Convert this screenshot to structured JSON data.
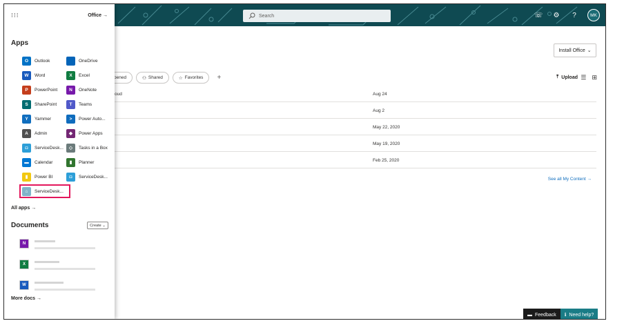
{
  "topbar": {
    "search_placeholder": "Search",
    "avatar_initials": "MK",
    "icons": [
      "settings-icon",
      "help-icon",
      "feedback-icon"
    ]
  },
  "launcher": {
    "office_link": "Office",
    "apps_title": "Apps",
    "apps": [
      {
        "label": "Outlook",
        "icon": "outlook-icon",
        "color": "#0072c6",
        "glyph": "O"
      },
      {
        "label": "OneDrive",
        "icon": "onedrive-icon",
        "color": "#0364b8",
        "glyph": ""
      },
      {
        "label": "Word",
        "icon": "word-icon",
        "color": "#185abd",
        "glyph": "W"
      },
      {
        "label": "Excel",
        "icon": "excel-icon",
        "color": "#107c41",
        "glyph": "X"
      },
      {
        "label": "PowerPoint",
        "icon": "powerpoint-icon",
        "color": "#c43e1c",
        "glyph": "P"
      },
      {
        "label": "OneNote",
        "icon": "onenote-icon",
        "color": "#7719aa",
        "glyph": "N"
      },
      {
        "label": "SharePoint",
        "icon": "sharepoint-icon",
        "color": "#036c70",
        "glyph": "S"
      },
      {
        "label": "Teams",
        "icon": "teams-icon",
        "color": "#5059c9",
        "glyph": "T"
      },
      {
        "label": "Yammer",
        "icon": "yammer-icon",
        "color": "#106ebe",
        "glyph": "Y"
      },
      {
        "label": "Power Auto...",
        "icon": "power-automate-icon",
        "color": "#0f6cbd",
        "glyph": ">"
      },
      {
        "label": "Admin",
        "icon": "admin-icon",
        "color": "#505050",
        "glyph": "A"
      },
      {
        "label": "Power Apps",
        "icon": "power-apps-icon",
        "color": "#742774",
        "glyph": "◆"
      },
      {
        "label": "ServiceDesk...",
        "icon": "servicedesk-icon",
        "color": "#2d9fd8",
        "glyph": "◘"
      },
      {
        "label": "Tasks in a Box",
        "icon": "tasks-in-a-box-icon",
        "color": "#6b7b7b",
        "glyph": "◇"
      },
      {
        "label": "Calendar",
        "icon": "calendar-icon",
        "color": "#0078d4",
        "glyph": "▬"
      },
      {
        "label": "Planner",
        "icon": "planner-icon",
        "color": "#31752f",
        "glyph": "▮"
      },
      {
        "label": "Power BI",
        "icon": "power-bi-icon",
        "color": "#f2c811",
        "glyph": "▮"
      },
      {
        "label": "ServiceDesk...",
        "icon": "servicedesk-icon",
        "color": "#2d9fd8",
        "glyph": "◘"
      },
      {
        "label": "ServiceDesk...",
        "icon": "servicedesk-web-icon",
        "color": "#7fb3c9",
        "glyph": "⌂"
      }
    ],
    "all_apps": "All apps",
    "documents_title": "Documents",
    "create_label": "Create",
    "documents": [
      {
        "icon": "onenote-doc-icon",
        "color": "#7719aa",
        "glyph": "N"
      },
      {
        "icon": "excel-doc-icon",
        "color": "#107c41",
        "glyph": "X"
      },
      {
        "icon": "word-doc-icon",
        "color": "#185abd",
        "glyph": "W"
      }
    ],
    "more_docs": "More docs"
  },
  "main": {
    "install_office": "Install Office",
    "filters": [
      "pened",
      "Shared",
      "Favorites"
    ],
    "upload_label": "Upload",
    "rows": [
      {
        "name": "oud",
        "date": "Aug 24"
      },
      {
        "name": "",
        "date": "Aug 2"
      },
      {
        "name": "",
        "date": "May 22, 2020"
      },
      {
        "name": "",
        "date": "May 19, 2020"
      },
      {
        "name": "",
        "date": "Feb 25, 2020"
      }
    ],
    "see_all": "See all My Content"
  },
  "footer": {
    "feedback": "Feedback",
    "need_help": "Need help?"
  }
}
